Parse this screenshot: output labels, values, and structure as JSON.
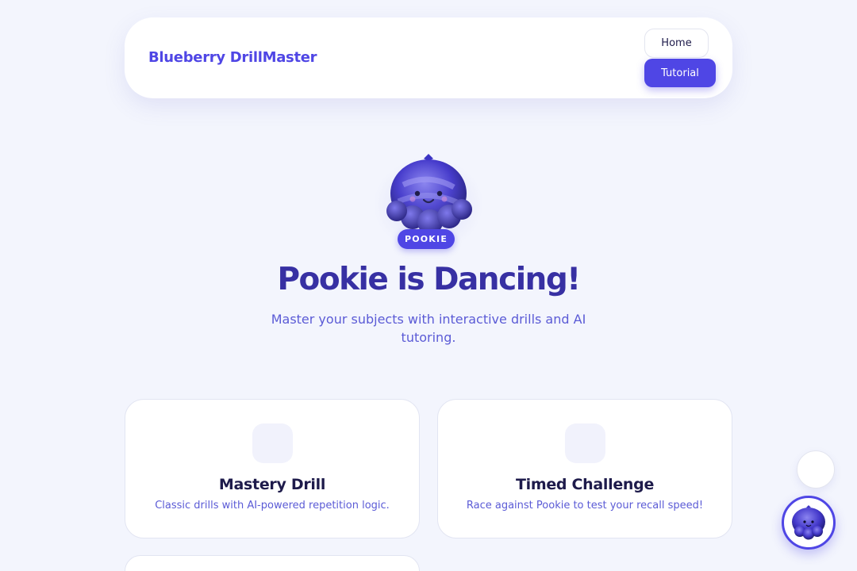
{
  "header": {
    "brand": "Blueberry DrillMaster",
    "nav": {
      "home": "Home",
      "tutorial": "Tutorial"
    }
  },
  "hero": {
    "mascot_icon": "blueberry-mascot-icon",
    "badge": "POOKIE",
    "title": "Pookie is Dancing!",
    "subtitle": "Master your subjects with interactive drills and AI tutoring."
  },
  "cards": [
    {
      "title": "Mastery Drill",
      "description": "Classic drills with AI-powered repetition logic."
    },
    {
      "title": "Timed Challenge",
      "description": "Race against Pookie to test your recall speed!"
    }
  ],
  "floating": {
    "blank_button_icon": "blank-icon",
    "mascot_button_icon": "blueberry-mascot-icon"
  },
  "colors": {
    "accent": "#4f46e5",
    "background": "#f3f5fd",
    "heading": "#3730a3",
    "text_muted": "#5b5bd6"
  }
}
